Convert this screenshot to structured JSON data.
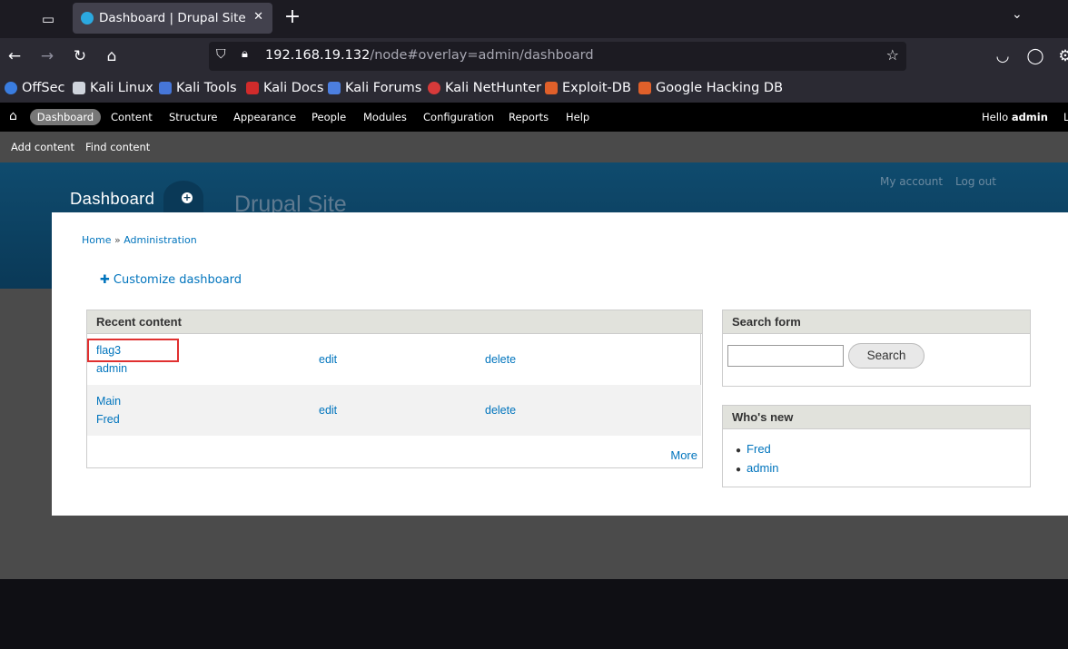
{
  "browser": {
    "tab_title": "Dashboard | Drupal Site",
    "url_host": "192.168.19.132",
    "url_path": "/node#overlay=admin/dashboard",
    "bookmarks": [
      "OffSec",
      "Kali Linux",
      "Kali Tools",
      "Kali Docs",
      "Kali Forums",
      "Kali NetHunter",
      "Exploit-DB",
      "Google Hacking DB"
    ]
  },
  "toolbar": {
    "items": [
      "Dashboard",
      "Content",
      "Structure",
      "Appearance",
      "People",
      "Modules",
      "Configuration",
      "Reports",
      "Help"
    ],
    "hello_prefix": "Hello ",
    "username": "admin",
    "trailing": "L",
    "shortcuts": [
      "Add content",
      "Find content"
    ]
  },
  "site": {
    "name": "Drupal Site",
    "links": [
      "My account",
      "Log out"
    ]
  },
  "overlay": {
    "title": "Dashboard",
    "breadcrumb_home": "Home",
    "breadcrumb_sep": " » ",
    "breadcrumb_admin": "Administration",
    "customize": "Customize dashboard",
    "recent_content": {
      "title": "Recent content",
      "rows": [
        {
          "title": "flag3",
          "author": "admin",
          "edit": "edit",
          "delete": "delete"
        },
        {
          "title": "Main",
          "author": "Fred",
          "edit": "edit",
          "delete": "delete"
        }
      ],
      "more": "More"
    },
    "search_form": {
      "title": "Search form",
      "button": "Search",
      "value": ""
    },
    "whos_new": {
      "title": "Who's new",
      "users": [
        "Fred",
        "admin"
      ]
    }
  },
  "colors": {
    "link": "#0074bd",
    "highlight": "#e03030",
    "header": "#0a3957"
  }
}
